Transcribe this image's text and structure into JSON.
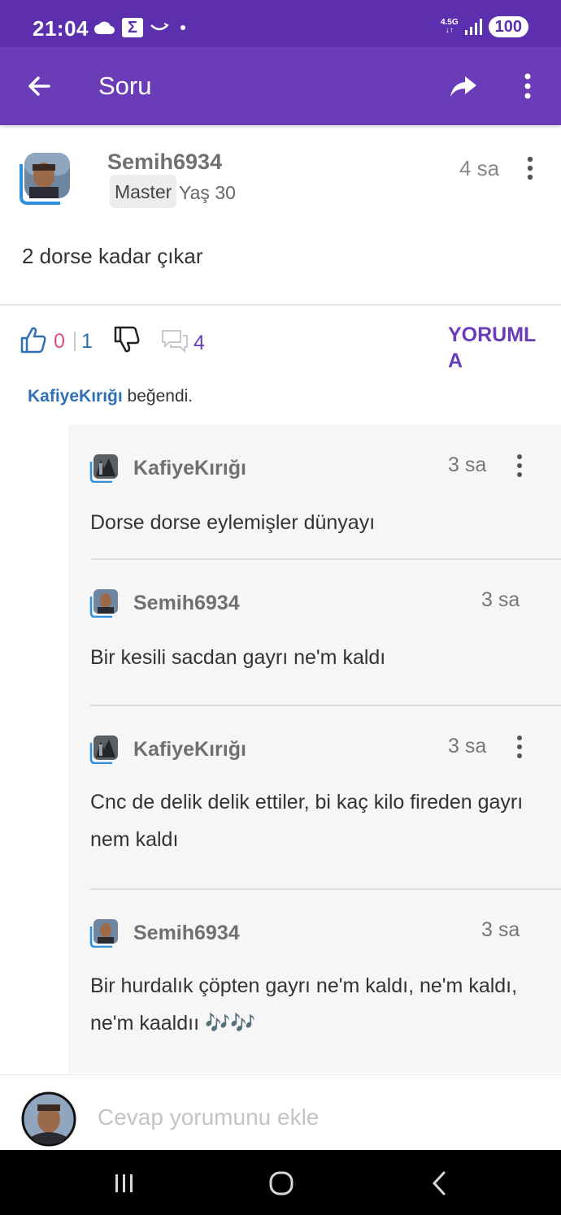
{
  "status_bar": {
    "time": "21:04",
    "net_label": "4.5G",
    "battery": "100"
  },
  "app_bar": {
    "title": "Soru"
  },
  "post": {
    "author": "Semih6934",
    "rank": "Master",
    "age": "Yaş 30",
    "time": "4 sa",
    "text": "2 dorse kadar çıkar"
  },
  "actions": {
    "likes": "0",
    "dislikes": "1",
    "comments": "4",
    "comment_button": "YORUMLA",
    "liked_by_user": "KafiyeKırığı",
    "liked_by_suffix": "beğendi."
  },
  "comments": [
    {
      "author": "KafiyeKırığı",
      "time": "3 sa",
      "text": "Dorse dorse eylemişler dünyayı"
    },
    {
      "author": "Semih6934",
      "time": "3 sa",
      "text": "Bir kesili sacdan gayrı ne'm kaldı"
    },
    {
      "author": "KafiyeKırığı",
      "time": "3 sa",
      "text": "Cnc de delik delik ettiler, bi kaç kilo fireden gayrı nem kaldı"
    },
    {
      "author": "Semih6934",
      "time": "3 sa",
      "text": "Bir hurdalık çöpten gayrı ne'm kaldı, ne'm kaldı, ne'm kaaldıı 🎶🎶"
    }
  ],
  "input": {
    "placeholder": "Cevap yorumunu ekle"
  },
  "colors": {
    "status_bar": "#5b2fae",
    "app_bar": "#6a3cb8",
    "like": "#e0507a",
    "dislike": "#2f6fb6",
    "accent": "#6a3cb8"
  },
  "icons": [
    "back-arrow-icon",
    "share-icon",
    "more-vert-icon",
    "thumbs-up-icon",
    "thumbs-down-icon",
    "comment-bubble-icon",
    "recents-icon",
    "home-icon",
    "back-nav-icon"
  ]
}
